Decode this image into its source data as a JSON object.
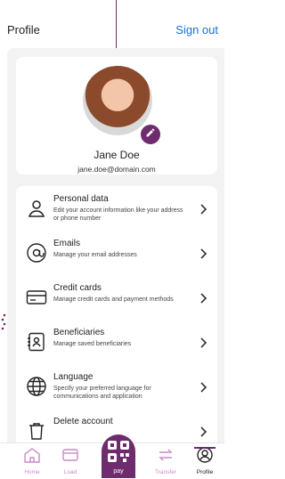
{
  "header": {
    "title": "Profile",
    "signout": "Sign out"
  },
  "profile": {
    "name": "Jane Doe",
    "email": "jane.doe@domain.com"
  },
  "menu": [
    {
      "title": "Personal data",
      "desc": "Edit your account information like your address or phone number",
      "icon": "user-icon"
    },
    {
      "title": "Emails",
      "desc": "Manage your email addresses",
      "icon": "at-icon"
    },
    {
      "title": "Credit cards",
      "desc": "Manage credit cards and payment methods",
      "icon": "credit-card-icon"
    },
    {
      "title": "Beneficiaries",
      "desc": "Manage saved beneficiaries",
      "icon": "contact-card-icon"
    },
    {
      "title": "Language",
      "desc": "Specify your preferred language for communications and application",
      "icon": "globe-icon"
    },
    {
      "title": "Delete account",
      "desc": "",
      "icon": "trash-icon"
    }
  ],
  "nav": [
    {
      "label": "Home",
      "icon": "home-icon"
    },
    {
      "label": "Load",
      "icon": "wallet-icon"
    },
    {
      "label": "pay",
      "icon": "qr-icon"
    },
    {
      "label": "Transfer",
      "icon": "transfer-icon"
    },
    {
      "label": "Profile",
      "icon": "profile-icon"
    }
  ],
  "colors": {
    "accent": "#6e2b6e",
    "link": "#1a6fd8"
  }
}
